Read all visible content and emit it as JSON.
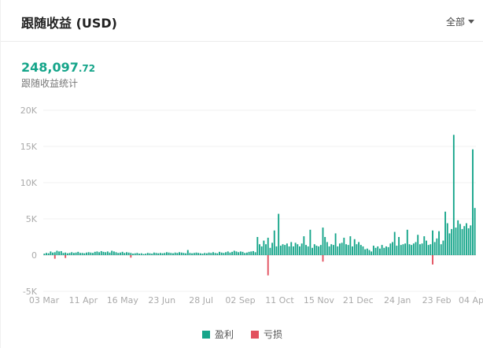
{
  "header": {
    "title": "跟随收益 (USD)",
    "filter_label": "全部"
  },
  "summary": {
    "total_main": "248,097",
    "total_decimal": ".72",
    "subtitle": "跟随收益统计"
  },
  "colors": {
    "profit": "#16a58a",
    "loss": "#e2505e"
  },
  "legend": [
    {
      "label": "盈利",
      "color": "#16a58a"
    },
    {
      "label": "亏损",
      "color": "#e2505e"
    }
  ],
  "chart_data": {
    "type": "bar",
    "title": "",
    "xlabel": "",
    "ylabel": "",
    "ylim": [
      -5000,
      20000
    ],
    "y_ticks": [
      {
        "value": 20000,
        "label": "20K"
      },
      {
        "value": 15000,
        "label": "15K"
      },
      {
        "value": 10000,
        "label": "10K"
      },
      {
        "value": 5000,
        "label": "5K"
      },
      {
        "value": 0,
        "label": "0"
      },
      {
        "value": -5000,
        "label": "-5K"
      }
    ],
    "x_tick_labels": [
      "03 Mar",
      "11 Apr",
      "16 May",
      "23 Jun",
      "28 Jul",
      "02 Sep",
      "11 Oct",
      "15 Nov",
      "21 Dec",
      "24 Jan",
      "23 Feb",
      "04 Ap"
    ],
    "grid": true,
    "legend_position": "bottom",
    "series": [
      {
        "name": "盈利",
        "values": [
          200,
          300,
          250,
          500,
          350,
          400,
          600,
          500,
          550,
          300,
          350,
          250,
          300,
          400,
          300,
          350,
          450,
          300,
          300,
          250,
          350,
          400,
          350,
          300,
          450,
          500,
          400,
          550,
          450,
          400,
          500,
          350,
          600,
          500,
          400,
          300,
          350,
          450,
          300,
          400,
          350,
          300,
          200,
          250,
          300,
          200,
          250,
          150,
          200,
          300,
          250,
          200,
          350,
          300,
          250,
          300,
          250,
          300,
          400,
          350,
          300,
          250,
          350,
          300,
          400,
          350,
          300,
          250,
          700,
          300,
          250,
          300,
          350,
          300,
          250,
          200,
          300,
          250,
          350,
          300,
          400,
          300,
          250,
          450,
          350,
          300,
          400,
          500,
          350,
          450,
          600,
          500,
          400,
          500,
          450,
          300,
          350,
          450,
          500,
          550,
          400,
          2500,
          1500,
          1200,
          2000,
          1500,
          2400,
          1000,
          1700,
          3400,
          1200,
          5700,
          1300,
          1500,
          1400,
          1600,
          1200,
          1800,
          1200,
          1700,
          1500,
          1200,
          1600,
          2600,
          1400,
          1200,
          3500,
          1000,
          1500,
          1300,
          1200,
          1400,
          3800,
          2500,
          1800,
          1200,
          1500,
          1400,
          3000,
          1200,
          1600,
          1700,
          2400,
          1500,
          1400,
          2600,
          1200,
          2200,
          1500,
          1800,
          1400,
          1200,
          800,
          900,
          700,
          500,
          1300,
          1000,
          1200,
          900,
          1400,
          1000,
          1200,
          1100,
          1600,
          1800,
          3200,
          1300,
          2500,
          1400,
          1500,
          1600,
          3500,
          1500,
          1400,
          1600,
          1800,
          2800,
          1500,
          1600,
          2600,
          2000,
          1400,
          1500,
          3400,
          1800,
          2300,
          3300,
          1500,
          2000,
          6000,
          4400,
          3000,
          3600,
          16600,
          3800,
          4800,
          4300,
          3600,
          4000,
          4400,
          3700,
          4100,
          14600,
          6500
        ],
        "color": "#16a58a"
      },
      {
        "name": "亏损",
        "values": [
          0,
          0,
          0,
          0,
          0,
          -500,
          0,
          0,
          0,
          0,
          -400,
          0,
          0,
          0,
          0,
          0,
          0,
          0,
          0,
          0,
          0,
          0,
          0,
          0,
          0,
          0,
          0,
          0,
          0,
          0,
          0,
          0,
          0,
          0,
          0,
          0,
          0,
          0,
          0,
          0,
          0,
          -350,
          0,
          0,
          0,
          0,
          0,
          0,
          0,
          0,
          0,
          0,
          0,
          0,
          0,
          0,
          0,
          0,
          0,
          0,
          0,
          0,
          0,
          0,
          0,
          0,
          0,
          0,
          0,
          0,
          0,
          0,
          0,
          0,
          0,
          0,
          0,
          0,
          0,
          0,
          0,
          0,
          0,
          0,
          0,
          0,
          0,
          0,
          0,
          0,
          0,
          0,
          0,
          0,
          0,
          0,
          0,
          0,
          0,
          0,
          0,
          0,
          0,
          0,
          0,
          0,
          -2800,
          0,
          0,
          0,
          0,
          0,
          0,
          0,
          0,
          0,
          0,
          0,
          0,
          0,
          0,
          0,
          0,
          0,
          0,
          0,
          0,
          0,
          0,
          0,
          0,
          0,
          -900,
          0,
          0,
          0,
          0,
          0,
          0,
          0,
          0,
          0,
          0,
          0,
          0,
          0,
          0,
          0,
          0,
          0,
          0,
          0,
          0,
          0,
          0,
          0,
          0,
          0,
          0,
          0,
          0,
          0,
          0,
          0,
          0,
          0,
          0,
          0,
          0,
          0,
          0,
          0,
          0,
          0,
          0,
          0,
          0,
          0,
          0,
          0,
          0,
          0,
          0,
          0,
          -1300,
          0,
          0,
          0,
          0,
          0,
          0,
          0,
          0,
          0,
          0,
          0,
          0,
          0,
          0,
          0,
          0,
          0,
          0,
          0,
          0
        ],
        "color": "#e2505e"
      }
    ]
  }
}
